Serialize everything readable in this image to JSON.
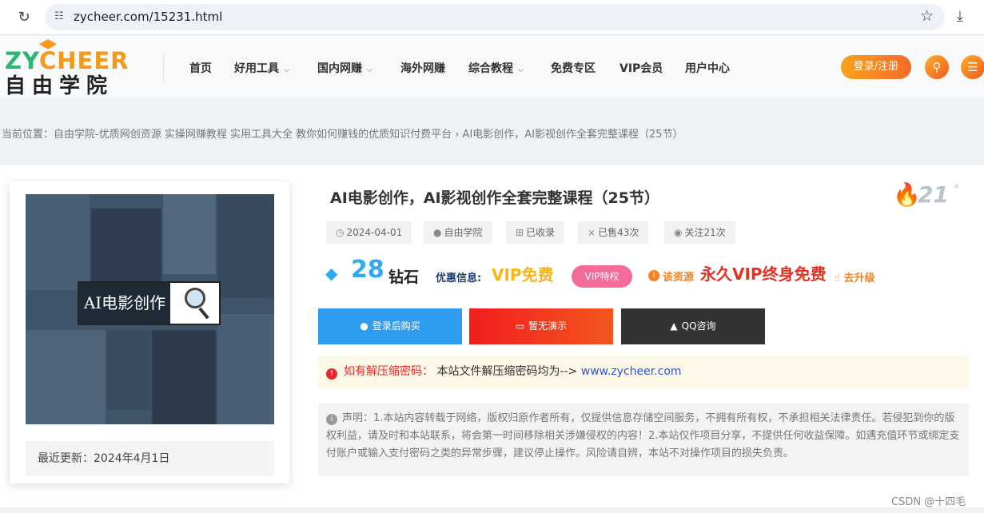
{
  "browser": {
    "url": "zycheer.com/15231.html",
    "reload_icon": "reload-icon",
    "star_icon": "star-icon",
    "download_icon": "download-icon"
  },
  "header": {
    "logo_top_a": "ZY",
    "logo_top_b": "CHEER",
    "logo_bottom": "自由学院",
    "nav": [
      {
        "label": "首页",
        "dropdown": false
      },
      {
        "label": "好用工具",
        "dropdown": true
      },
      {
        "label": "国内网赚",
        "dropdown": true
      },
      {
        "label": "海外网赚",
        "dropdown": false
      },
      {
        "label": "综合教程",
        "dropdown": true
      },
      {
        "label": "免费专区",
        "dropdown": false
      },
      {
        "label": "VIP会员",
        "dropdown": false
      },
      {
        "label": "用户中心",
        "dropdown": false
      }
    ],
    "login_label": "登录/注册",
    "colors": {
      "brand_green": "#2bb673",
      "brand_orange": "#f39a1c"
    }
  },
  "breadcrumb": {
    "text": "当前位置：自由学院-优质网创资源 实操网赚教程 实用工具大全 教你如何赚钱的优质知识付费平台 › AI电影创作，AI影视创作全套完整课程（25节）"
  },
  "product": {
    "cover_text": "AI电影创作",
    "update_label": "最近更新：2024年4月1日",
    "title": "AI电影创作，AI影视创作全套完整课程（25节）",
    "hot_value": "21",
    "hot_degree": "°",
    "meta": [
      {
        "icon": "clock-icon",
        "label": "2024-04-01"
      },
      {
        "icon": "user-icon",
        "label": "自由学院"
      },
      {
        "icon": "windows-icon",
        "label": "已收录"
      },
      {
        "icon": "cart-icon",
        "label": "已售43次"
      },
      {
        "icon": "eye-icon",
        "label": "关注21次"
      }
    ],
    "price": "28",
    "price_unit": "钻石",
    "promo_label": "优惠信息:",
    "vip_free": "VIP免费",
    "vip_badge": "VIP特权",
    "resource_label": "该资源",
    "lifetime_label": "永久VIP终身免费",
    "upgrade_label": "去升级",
    "buttons": [
      {
        "label": "登录后购买",
        "icon": "user-icon",
        "color": "#2f9cf0"
      },
      {
        "label": "暂无演示",
        "icon": "monitor-icon",
        "color": "#f23a1c"
      },
      {
        "label": "QQ咨询",
        "icon": "qq-icon",
        "color": "#333333"
      }
    ],
    "password_label": "如有解压缩密码：",
    "password_text": "本站文件解压缩密码均为-->",
    "password_link": "www.zycheer.com",
    "notice": "声明：1.本站内容转载于网络，版权归原作者所有，仅提供信息存储空间服务，不拥有所有权，不承担相关法律责任。若侵犯到你的版权利益，请及时和本站联系，将会第一时间移除相关涉嫌侵权的内容！2.本站仅作项目分享，不提供任何收益保障。如遇充值环节或绑定支付账户或输入支付密码之类的异常步骤，建议停止操作。风险请自辨，本站不对操作项目的损失负责。"
  },
  "watermark": "CSDN @十四毛"
}
